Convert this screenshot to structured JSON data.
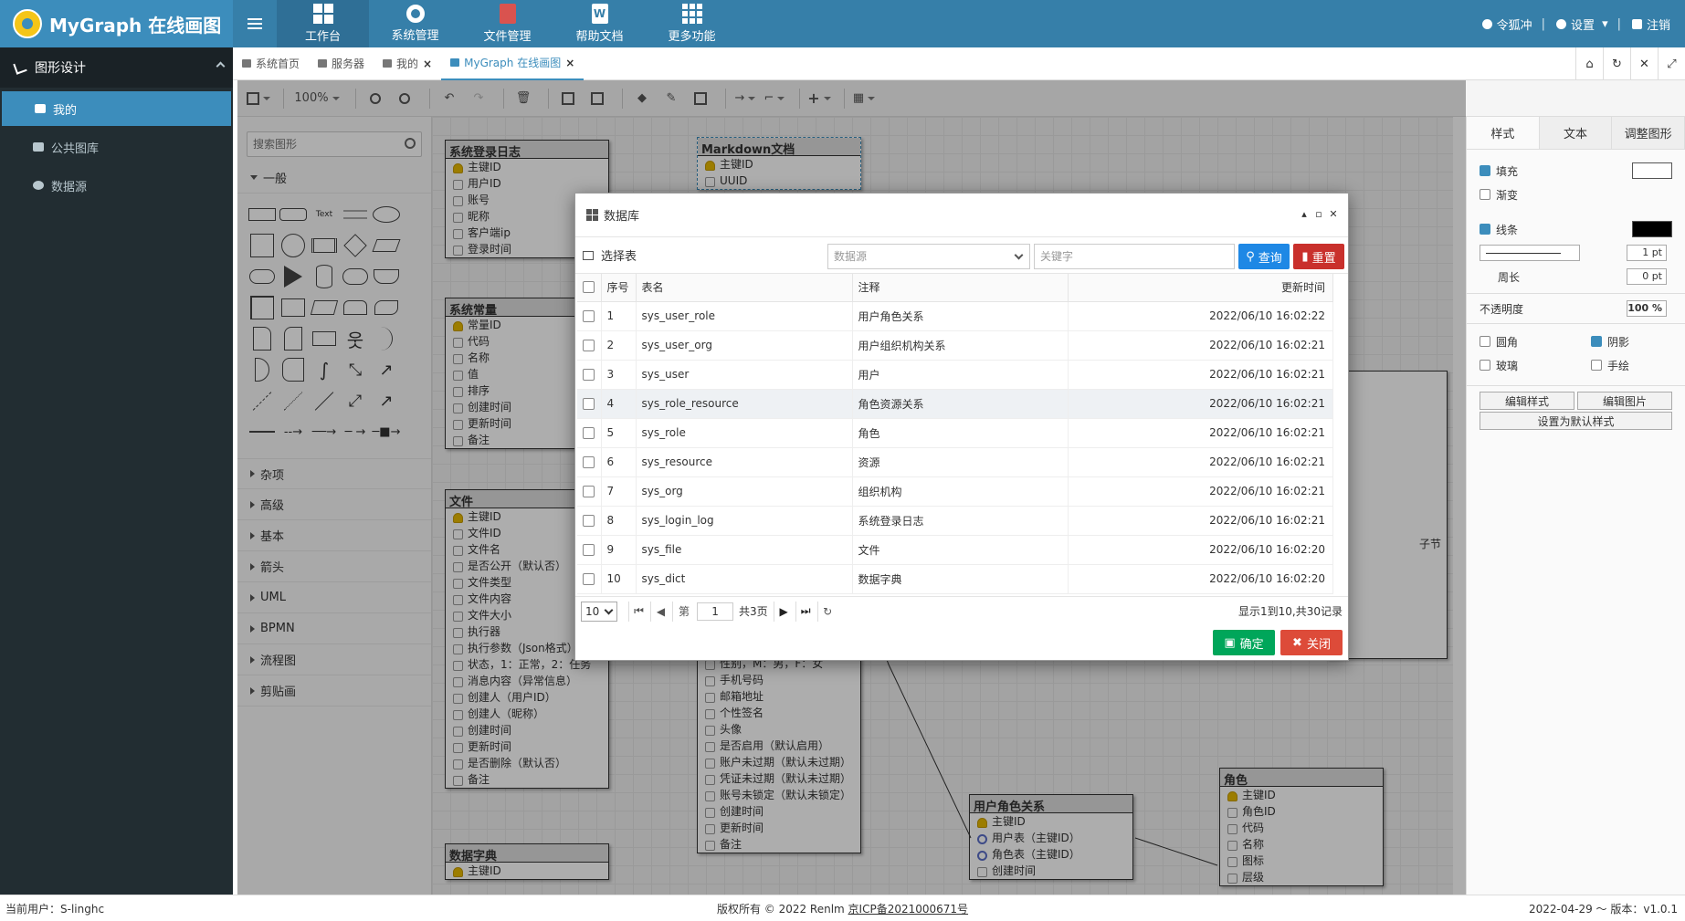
{
  "brand": {
    "title": "MyGraph 在线画图"
  },
  "nav": [
    {
      "label": "工作台",
      "icon": "windows-icon",
      "active": true
    },
    {
      "label": "系统管理",
      "icon": "gear-icon"
    },
    {
      "label": "文件管理",
      "icon": "file-icon"
    },
    {
      "label": "帮助文档",
      "icon": "word-doc-icon"
    },
    {
      "label": "更多功能",
      "icon": "grid-icon"
    }
  ],
  "user_menu": {
    "user": "令狐冲",
    "settings": "设置",
    "logout": "注销"
  },
  "sidebar": {
    "header": "图形设计",
    "items": [
      {
        "label": "我的",
        "active": true
      },
      {
        "label": "公共图库"
      },
      {
        "label": "数据源"
      }
    ]
  },
  "tabs": [
    {
      "label": "系统首页"
    },
    {
      "label": "服务器"
    },
    {
      "label": "我的",
      "closable": true
    },
    {
      "label": "MyGraph 在线画图",
      "closable": true,
      "active": true
    }
  ],
  "toolbar": {
    "zoom": "100%"
  },
  "shapes": {
    "search_placeholder": "搜索图形",
    "text_shape_label": "Text",
    "categories_open": "一般",
    "categories": [
      "杂项",
      "高级",
      "基本",
      "箭头",
      "UML",
      "BPMN",
      "流程图",
      "剪贴画"
    ]
  },
  "entities": {
    "login_log": {
      "title": "系统登录日志",
      "rows": [
        "主键ID",
        "用户ID",
        "账号",
        "昵称",
        "客户端ip",
        "登录时间"
      ]
    },
    "markdown": {
      "title": "Markdown文档",
      "rows": [
        "主键ID",
        "UUID"
      ]
    },
    "constant": {
      "title": "系统常量",
      "rows": [
        "常量ID",
        "代码",
        "名称",
        "值",
        "排序",
        "创建时间",
        "更新时间",
        "备注"
      ]
    },
    "file": {
      "title": "文件",
      "rows": [
        "主键ID",
        "文件ID",
        "文件名",
        "是否公开（默认否）",
        "文件类型",
        "文件内容",
        "文件大小",
        "执行器",
        "执行参数（Json格式）",
        "状态，1：正常，2：任务",
        "消息内容（异常信息）",
        "创建人（用户ID）",
        "创建人（昵称）",
        "创建时间",
        "更新时间",
        "是否删除（默认否）",
        "备注"
      ]
    },
    "user": {
      "rows": [
        "性别，M：男，F：女",
        "手机号码",
        "邮箱地址",
        "个性签名",
        "头像",
        "是否启用（默认启用）",
        "账户未过期（默认未过期）",
        "凭证未过期（默认未过期）",
        "账号未锁定（默认未锁定）",
        "创建时间",
        "更新时间",
        "备注"
      ]
    },
    "user_role": {
      "title": "用户角色关系",
      "rows": [
        "主键ID",
        "用户表（主键ID）",
        "角色表（主键ID）",
        "创建时间"
      ]
    },
    "role": {
      "title": "角色",
      "rows": [
        "主键ID",
        "角色ID",
        "代码",
        "名称",
        "图标",
        "层级"
      ]
    },
    "dict": {
      "title": "数据字典",
      "rows": [
        "主键ID"
      ]
    },
    "partial_text": "子节"
  },
  "format_panel": {
    "tabs": [
      "样式",
      "文本",
      "调整图形"
    ],
    "fill": "填充",
    "gradient": "渐变",
    "line": "线条",
    "line_width": "1 pt",
    "perimeter": "周长",
    "perimeter_value": "0 pt",
    "opacity": "不透明度",
    "opacity_value": "100 %",
    "rounded": "圆角",
    "shadow": "阴影",
    "glass": "玻璃",
    "sketch": "手绘",
    "edit_style": "编辑样式",
    "edit_image": "编辑图片",
    "set_default": "设置为默认样式"
  },
  "dialog": {
    "title": "数据库",
    "select_table": "选择表",
    "datasource_placeholder": "数据源",
    "keyword_placeholder": "关键字",
    "query": "查询",
    "reset": "重置",
    "columns": {
      "no": "序号",
      "name": "表名",
      "note": "注释",
      "updated": "更新时间"
    },
    "rows": [
      {
        "no": "1",
        "name": "sys_user_role",
        "note": "用户角色关系",
        "updated": "2022/06/10 16:02:22"
      },
      {
        "no": "2",
        "name": "sys_user_org",
        "note": "用户组织机构关系",
        "updated": "2022/06/10 16:02:21"
      },
      {
        "no": "3",
        "name": "sys_user",
        "note": "用户",
        "updated": "2022/06/10 16:02:21"
      },
      {
        "no": "4",
        "name": "sys_role_resource",
        "note": "角色资源关系",
        "updated": "2022/06/10 16:02:21"
      },
      {
        "no": "5",
        "name": "sys_role",
        "note": "角色",
        "updated": "2022/06/10 16:02:21"
      },
      {
        "no": "6",
        "name": "sys_resource",
        "note": "资源",
        "updated": "2022/06/10 16:02:21"
      },
      {
        "no": "7",
        "name": "sys_org",
        "note": "组织机构",
        "updated": "2022/06/10 16:02:21"
      },
      {
        "no": "8",
        "name": "sys_login_log",
        "note": "系统登录日志",
        "updated": "2022/06/10 16:02:21"
      },
      {
        "no": "9",
        "name": "sys_file",
        "note": "文件",
        "updated": "2022/06/10 16:02:20"
      },
      {
        "no": "10",
        "name": "sys_dict",
        "note": "数据字典",
        "updated": "2022/06/10 16:02:20"
      }
    ],
    "pager": {
      "page_size": "10",
      "page_prefix": "第",
      "page": "1",
      "total_pages": "共3页",
      "info": "显示1到10,共30记录"
    },
    "confirm": "确定",
    "close": "关闭"
  },
  "status": {
    "user": "当前用户：S-linghc",
    "copyright": "版权所有 © 2022 Renlm ",
    "icp": "京ICP备2021000671号",
    "version": "2022-04-29 ～ 版本：v1.0.1"
  }
}
